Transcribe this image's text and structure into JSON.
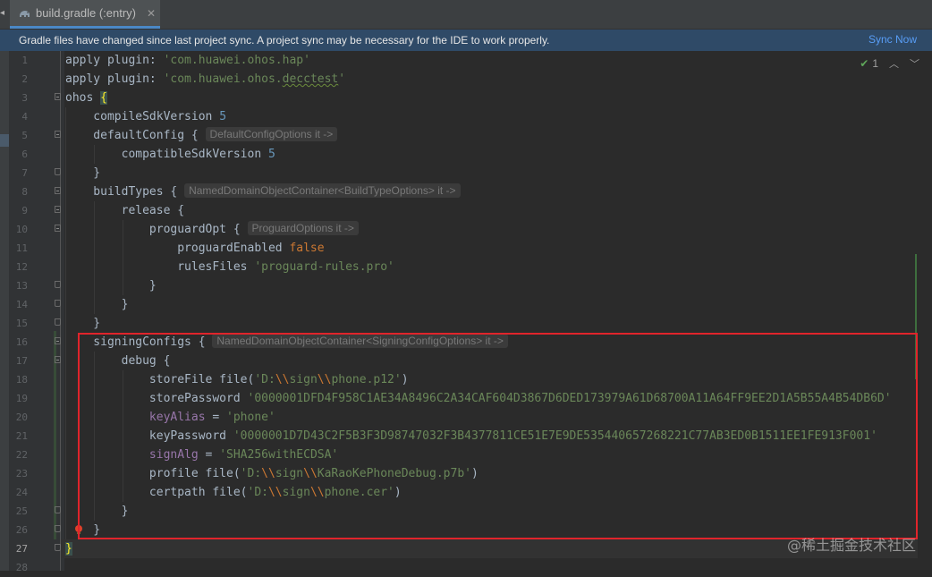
{
  "tab": {
    "label": "build.gradle (:entry)",
    "icon": "gradle-elephant-icon"
  },
  "notification": {
    "message": "Gradle files have changed since last project sync. A project sync may be necessary for the IDE to work properly.",
    "action": "Sync Now"
  },
  "inspection": {
    "count": "1"
  },
  "hints": {
    "default_config": "DefaultConfigOptions it ->",
    "build_types": "NamedDomainObjectContainer<BuildTypeOptions> it ->",
    "proguard": "ProguardOptions it ->",
    "signing_configs": "NamedDomainObjectContainer<SigningConfigOptions> it ->"
  },
  "code": {
    "l1_kw": "apply plugin: ",
    "l1_str": "'com.huawei.ohos.hap'",
    "l2_kw": "apply plugin: ",
    "l2_str_a": "'com.huawei.ohos.",
    "l2_str_b": "decctest",
    "l2_str_c": "'",
    "l3_kw": "ohos ",
    "l3_brace": "{",
    "l4_kw": "    compileSdkVersion ",
    "l4_num": "5",
    "l5_kw": "    defaultConfig { ",
    "l6_kw": "        compatibleSdkVersion ",
    "l6_num": "5",
    "l7_kw": "    }",
    "l8_kw": "    buildTypes { ",
    "l9_kw": "        release {",
    "l10_kw": "            proguardOpt { ",
    "l11_kw": "                proguardEnabled ",
    "l11_bool": "false",
    "l12_kw": "                rulesFiles ",
    "l12_str": "'proguard-rules.pro'",
    "l13_kw": "            }",
    "l14_kw": "        }",
    "l15_kw": "    }",
    "l16_kw": "    signingConfigs { ",
    "l17_kw": "        debug {",
    "l18_kw": "            storeFile file(",
    "l18_str_a": "'D:",
    "l18_esc_a": "\\\\",
    "l18_str_b": "sign",
    "l18_esc_b": "\\\\",
    "l18_str_c": "phone.p12'",
    "l18_close": ")",
    "l19_kw": "            storePassword ",
    "l19_str": "'0000001DFD4F958C1AE34A8496C2A34CAF604D3867D6DED173979A61D68700A11A64FF9EE2D1A5B55A4B54DB6D'",
    "l20_indent": "            ",
    "l20_prop": "keyAlias",
    "l20_eq": " = ",
    "l20_str": "'phone'",
    "l21_kw": "            keyPassword ",
    "l21_str": "'0000001D7D43C2F5B3F3D98747032F3B4377811CE51E7E9DE535440657268221C77AB3ED0B1511EE1FE913F001'",
    "l22_indent": "            ",
    "l22_prop": "signAlg",
    "l22_eq": " = ",
    "l22_str": "'SHA256withECDSA'",
    "l23_kw": "            profile file(",
    "l23_str_a": "'D:",
    "l23_esc_a": "\\\\",
    "l23_str_b": "sign",
    "l23_esc_b": "\\\\",
    "l23_str_c": "KaRaoKePhoneDebug.p7b'",
    "l23_close": ")",
    "l24_kw": "            certpath file(",
    "l24_str_a": "'D:",
    "l24_esc_a": "\\\\",
    "l24_str_b": "sign",
    "l24_esc_b": "\\\\",
    "l24_str_c": "phone.cer'",
    "l24_close": ")",
    "l25_kw": "        }",
    "l26_kw": "    }",
    "l27_brace": "}"
  },
  "line_numbers": [
    "1",
    "2",
    "3",
    "4",
    "5",
    "6",
    "7",
    "8",
    "9",
    "10",
    "11",
    "12",
    "13",
    "14",
    "15",
    "16",
    "17",
    "18",
    "19",
    "20",
    "21",
    "22",
    "23",
    "24",
    "25",
    "26",
    "27",
    "28"
  ],
  "watermark": "@稀土掘金技术社区",
  "colors": {
    "string": "#6a8759",
    "number": "#6897bb",
    "keyword": "#cc7832",
    "property": "#9876aa",
    "highlight_box": "#e0242b",
    "notification_bg": "#2f4a67",
    "link": "#589df6"
  }
}
